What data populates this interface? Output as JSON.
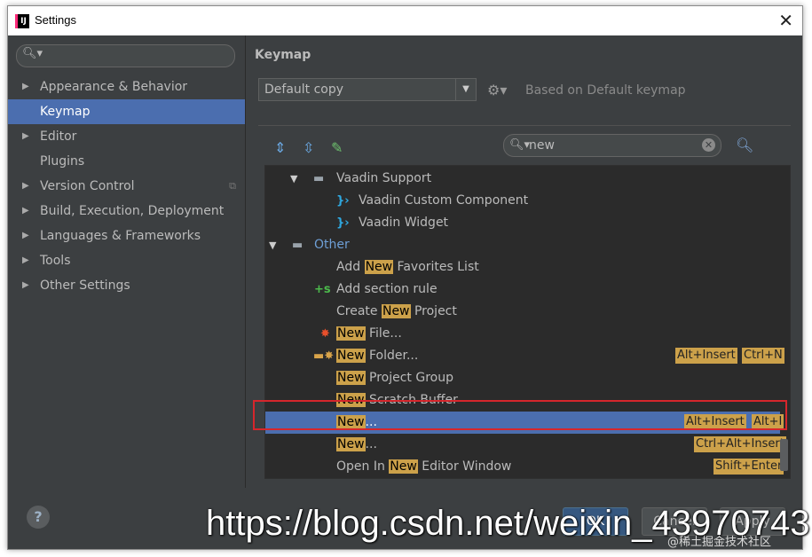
{
  "window": {
    "title": "Settings",
    "app_icon": "IJ"
  },
  "sidebar": {
    "search_placeholder": "",
    "items": [
      {
        "label": "Appearance & Behavior",
        "expandable": true
      },
      {
        "label": "Keymap",
        "expandable": false,
        "selected": true
      },
      {
        "label": "Editor",
        "expandable": true
      },
      {
        "label": "Plugins",
        "expandable": false
      },
      {
        "label": "Version Control",
        "expandable": true
      },
      {
        "label": "Build, Execution, Deployment",
        "expandable": true
      },
      {
        "label": "Languages & Frameworks",
        "expandable": true
      },
      {
        "label": "Tools",
        "expandable": true
      },
      {
        "label": "Other Settings",
        "expandable": true
      }
    ]
  },
  "main": {
    "title": "Keymap",
    "keymap_select": "Default copy",
    "based_on": "Based on Default keymap",
    "filter_value": "new"
  },
  "tree": {
    "rows": [
      {
        "parts": [
          "Vaadin Support"
        ],
        "highlight": []
      },
      {
        "parts": [
          "Vaadin Custom Component"
        ]
      },
      {
        "parts": [
          "Vaadin Widget"
        ]
      },
      {
        "parts": [
          "Other"
        ]
      },
      {
        "pre": "Add ",
        "hl": "New",
        "post": " Favorites List"
      },
      {
        "parts": [
          "Add section rule"
        ]
      },
      {
        "pre": "Create ",
        "hl": "New",
        "post": " Project"
      },
      {
        "pre": "",
        "hl": "New",
        "post": " File..."
      },
      {
        "pre": "",
        "hl": "New",
        "post": " Folder...",
        "shortcuts": [
          "Alt+Insert",
          "Ctrl+N"
        ]
      },
      {
        "pre": "",
        "hl": "New",
        "post": " Project Group"
      },
      {
        "pre": "",
        "hl": "New",
        "post": " Scratch Buffer"
      },
      {
        "pre": "",
        "hl": "New",
        "post": "...",
        "shortcuts": [
          "Alt+Insert",
          "Alt+I"
        ],
        "selected": true
      },
      {
        "pre": "",
        "hl": "New",
        "post": "...",
        "shortcuts": [
          "Ctrl+Alt+Insert"
        ]
      },
      {
        "pre": "Open In ",
        "hl": "New",
        "post": " Editor Window",
        "shortcuts": [
          "Shift+Enter"
        ]
      }
    ]
  },
  "footer": {
    "help": "?",
    "ok": "OK",
    "cancel": "Cancel",
    "apply": "Apply"
  },
  "watermark": {
    "url": "https://blog.csdn.net/weixin_43970743",
    "small": "@稀土掘金技术社区"
  },
  "colors": {
    "background": "#3c3f41",
    "selection": "#4b6eaf",
    "match_highlight": "#cca14a",
    "annotation_box": "#d6262c"
  }
}
